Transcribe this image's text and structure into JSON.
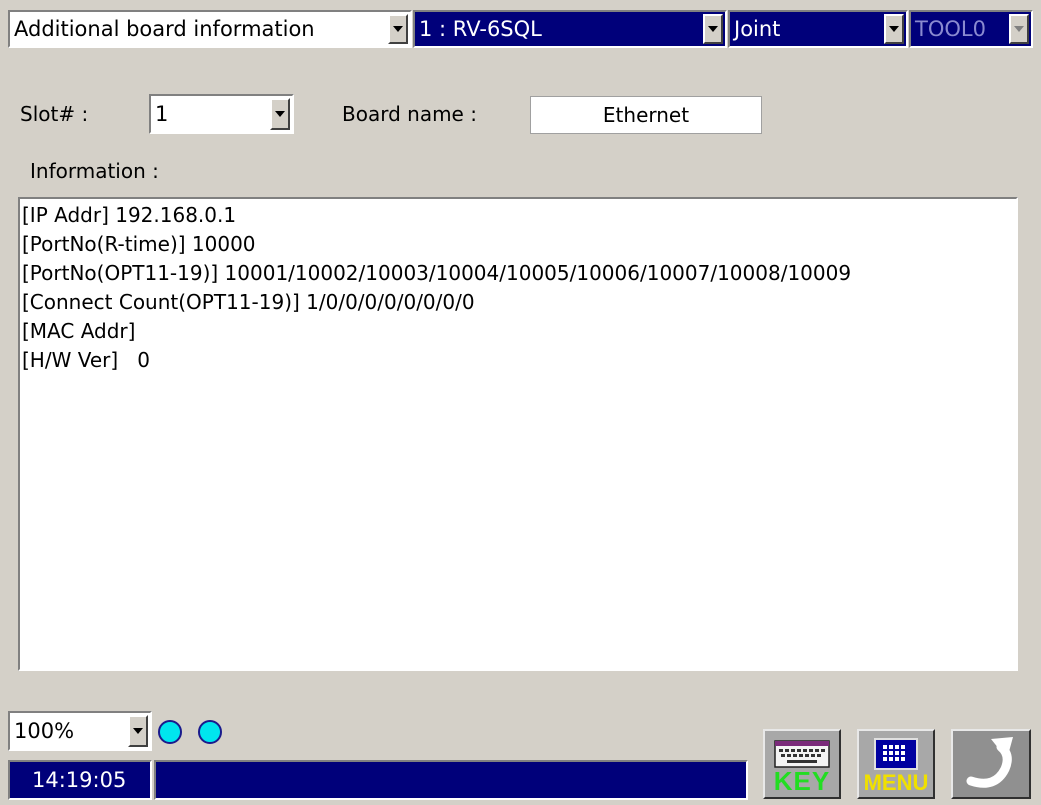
{
  "toolbar": {
    "screen_select": "Additional board information",
    "robot_select": "1 : RV-6SQL",
    "jog_mode_select": "Joint",
    "tool_select": "TOOL0"
  },
  "form": {
    "slot_label": "Slot# :",
    "slot_value": "1",
    "board_name_label": "Board name :",
    "board_name_value": "Ethernet",
    "information_label": "Information :"
  },
  "information": {
    "lines": [
      "[IP Addr] 192.168.0.1",
      "[PortNo(R-time)] 10000",
      "[PortNo(OPT11-19)] 10001/10002/10003/10004/10005/10006/10007/10008/10009",
      "[Connect Count(OPT11-19)] 1/0/0/0/0/0/0/0/0",
      "[MAC Addr]",
      "[H/W Ver]   0"
    ]
  },
  "status": {
    "speed_select": "100%",
    "time": "14:19:05",
    "message": "",
    "indicator_color": "#00e5ee"
  },
  "buttons": {
    "key_label": "KEY",
    "menu_label": "MENU",
    "back_icon": "return-arrow-icon"
  }
}
